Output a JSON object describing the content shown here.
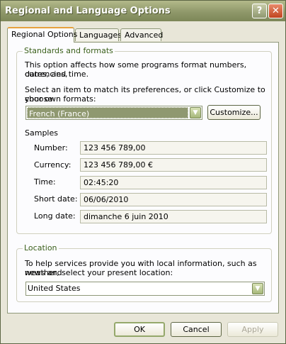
{
  "window": {
    "title": "Regional and Language Options",
    "help_glyph": "?",
    "close_glyph": "✕"
  },
  "tabs": [
    {
      "label": "Regional Options",
      "active": true
    },
    {
      "label": "Languages",
      "active": false
    },
    {
      "label": "Advanced",
      "active": false
    }
  ],
  "standards": {
    "legend": "Standards and formats",
    "desc_line1": "This option affects how some programs format numbers, currencies,",
    "desc_line2": "dates, and time.",
    "select_line1": "Select an item to match its preferences, or click Customize to choose",
    "select_line2": "your own formats:",
    "format_value": "French (France)",
    "customize_label": "Customize..."
  },
  "samples": {
    "heading": "Samples",
    "rows": [
      {
        "label": "Number:",
        "value": "123 456 789,00"
      },
      {
        "label": "Currency:",
        "value": "123 456 789,00 €"
      },
      {
        "label": "Time:",
        "value": "02:45:20"
      },
      {
        "label": "Short date:",
        "value": "06/06/2010"
      },
      {
        "label": "Long date:",
        "value": "dimanche 6 juin 2010"
      }
    ]
  },
  "location": {
    "legend": "Location",
    "desc_line1": "To help services provide you with local information, such as news and",
    "desc_line2": "weather, select your present location:",
    "value": "United States"
  },
  "footer": {
    "ok_label": "OK",
    "cancel_label": "Cancel",
    "apply_label": "Apply"
  },
  "colors": {
    "titlebar": "#8f986a",
    "accent_tab": "#e6a13d",
    "legend_text": "#3a5f1a"
  }
}
